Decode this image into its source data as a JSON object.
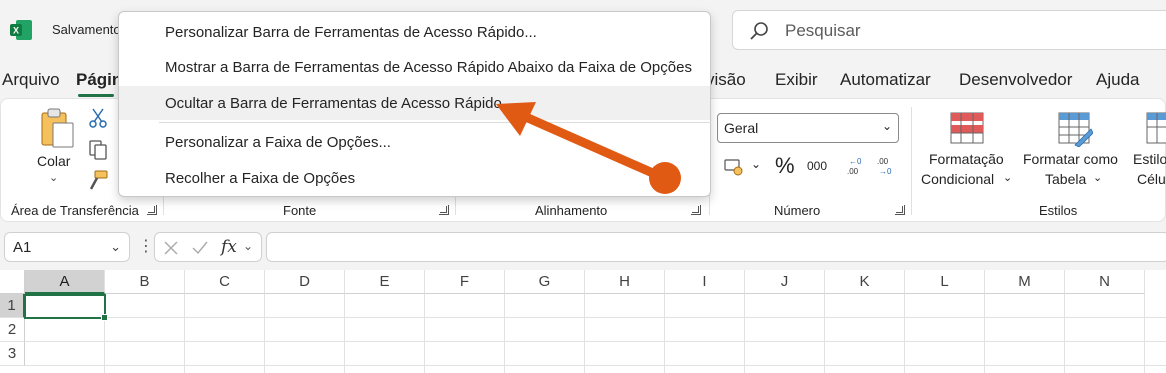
{
  "titlebar": {
    "logo_icon": "excel-logo-icon",
    "autosave_label": "Salvamento",
    "search_placeholder": "Pesquisar",
    "search_icon": "search-icon"
  },
  "tabs": [
    {
      "label": "Arquivo",
      "active": false
    },
    {
      "label": "Págin",
      "active": true
    },
    {
      "label": "visão",
      "active": false
    },
    {
      "label": "Exibir",
      "active": false
    },
    {
      "label": "Automatizar",
      "active": false
    },
    {
      "label": "Desenvolvedor",
      "active": false
    },
    {
      "label": "Ajuda",
      "active": false
    }
  ],
  "ribbon": {
    "clipboard": {
      "paste_label": "Colar",
      "group_label": "Área de Transferência"
    },
    "font": {
      "group_label": "Fonte"
    },
    "alignment": {
      "group_label": "Alinhamento"
    },
    "number": {
      "format_value": "Geral",
      "percent": "%",
      "thousands": "000",
      "dec_more": "←0 .00",
      "dec_less": ".00 →0",
      "group_label": "Número"
    },
    "styles": {
      "cond_format_line1": "Formatação",
      "cond_format_line2": "Condicional",
      "format_table_line1": "Formatar como",
      "format_table_line2": "Tabela",
      "cell_styles_line1": "Estilo",
      "cell_styles_line2": "Célu",
      "group_label": "Estilos"
    }
  },
  "formula_bar": {
    "name_box": "A1",
    "cancel_icon": "cancel-icon",
    "enter_icon": "check-icon",
    "fx_label": "fx",
    "formula_value": ""
  },
  "grid": {
    "columns": [
      "A",
      "B",
      "C",
      "D",
      "E",
      "F",
      "G",
      "H",
      "I",
      "J",
      "K",
      "L",
      "M",
      "N"
    ],
    "rows": [
      "1",
      "2",
      "3"
    ],
    "selected_cell": "A1"
  },
  "context_menu": {
    "items": [
      {
        "label": "Personalizar Barra de Ferramentas de Acesso Rápido..."
      },
      {
        "label": "Mostrar a Barra de Ferramentas de Acesso Rápido Abaixo da Faixa de Opções"
      },
      {
        "label": "Ocultar a Barra de Ferramentas de Acesso Rápido"
      },
      {
        "label": "Personalizar a Faixa de Opções..."
      },
      {
        "label": "Recolher a Faixa de Opções"
      }
    ]
  },
  "annotation": {
    "color": "#e05a14"
  }
}
